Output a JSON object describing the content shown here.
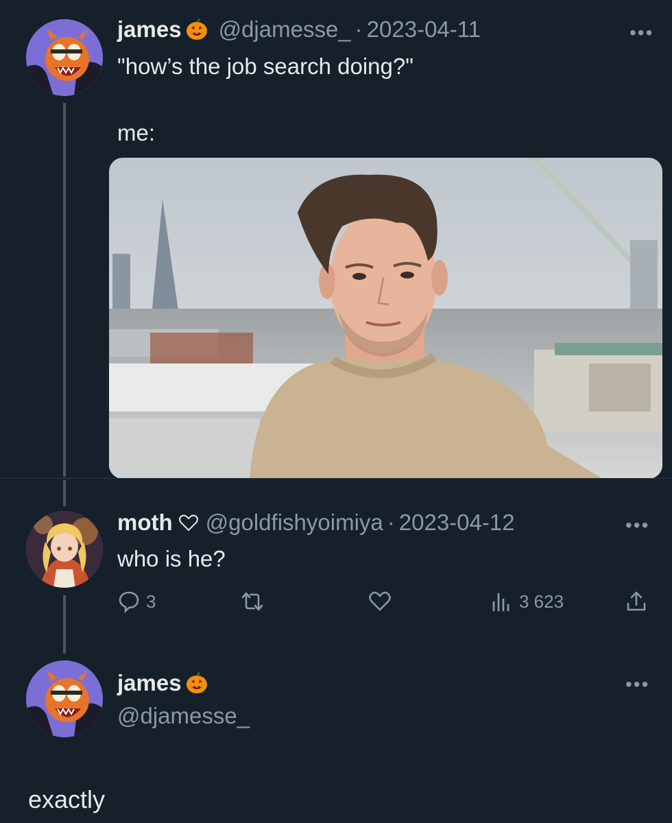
{
  "tweet1": {
    "display_name": "james",
    "name_emoji": "pumpkin-emoji",
    "handle": "@djamesse_",
    "separator": "·",
    "date": "2023-04-11",
    "text_line1": "\"how’s the job search doing?\"",
    "text_line2": "me:",
    "more": "•••"
  },
  "reply": {
    "display_name": "moth",
    "name_emoji": "white-heart-emoji",
    "handle": "@goldfishyoimiya",
    "separator": "·",
    "date": "2023-04-12",
    "text": "who is he?",
    "more": "•••",
    "actions": {
      "reply_count": "3",
      "retweet_count": "",
      "like_count": "",
      "view_count": "3 623"
    }
  },
  "tweet3": {
    "display_name": "james",
    "name_emoji": "pumpkin-emoji",
    "handle": "@djamesse_",
    "more": "•••"
  },
  "caption": "exactly",
  "colors": {
    "background": "#15202b",
    "text": "#e7e9ea",
    "muted": "#8b98a5",
    "pumpkin": "#f4900c"
  }
}
